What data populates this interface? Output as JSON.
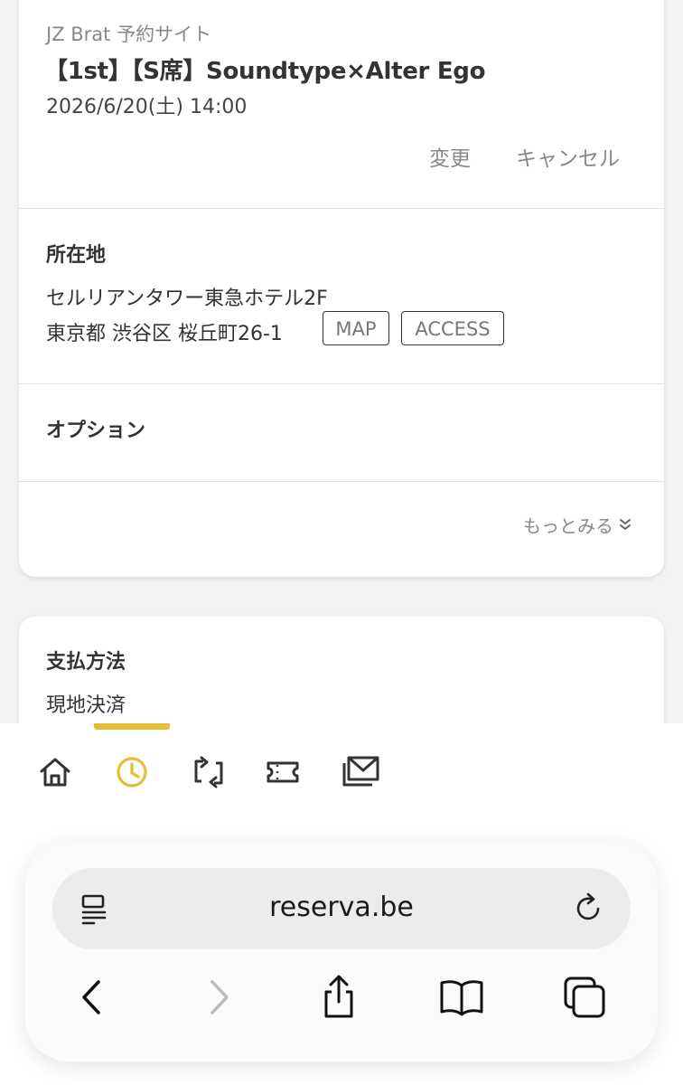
{
  "reservation": {
    "site_name": "JZ Brat 予約サイト",
    "title": "【1st】【S席】Soundtype×Alter Ego",
    "datetime": "2026/6/20(土) 14:00",
    "change_label": "変更",
    "cancel_label": "キャンセル"
  },
  "location": {
    "label": "所在地",
    "building": "セルリアンタワー東急ホテル2F",
    "address": "東京都 渋谷区 桜丘町26-1",
    "map_label": "MAP",
    "access_label": "ACCESS"
  },
  "options": {
    "label": "オプション"
  },
  "more": {
    "label": "もっとみる"
  },
  "payment": {
    "label": "支払方法",
    "method": "現地決済"
  },
  "tabs": [
    {
      "icon": "home-icon"
    },
    {
      "icon": "clock-icon",
      "active": true
    },
    {
      "icon": "repeat-icon"
    },
    {
      "icon": "ticket-icon"
    },
    {
      "icon": "mail-icon"
    }
  ],
  "browser": {
    "url": "reserva.be"
  },
  "colors": {
    "accent": "#e4bf35",
    "text": "#333333",
    "muted": "#888888"
  }
}
